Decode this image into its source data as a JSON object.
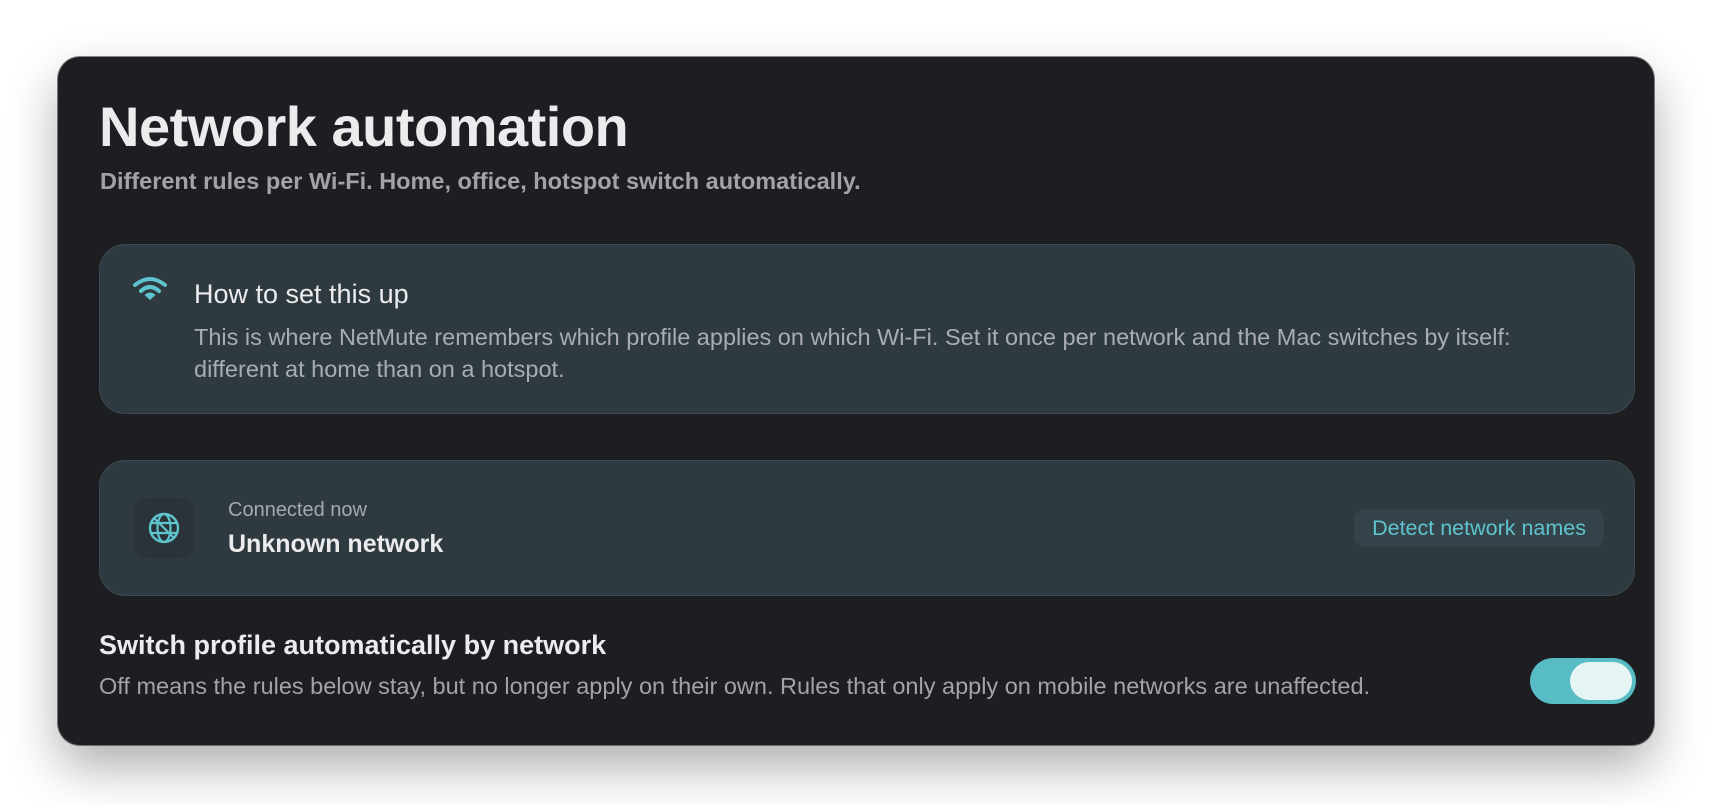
{
  "header": {
    "title": "Network automation",
    "subtitle": "Different rules per Wi-Fi. Home, office, hotspot switch automatically."
  },
  "info_card": {
    "icon": "wifi-icon",
    "title": "How to set this up",
    "body": "This is where NetMute remembers which profile applies on which Wi-Fi. Set it once per network and the Mac switches by itself: different at home than on a hotspot."
  },
  "network_card": {
    "icon": "globe-icon",
    "label": "Connected now",
    "network_name": "Unknown network",
    "detect_button_label": "Detect network names"
  },
  "auto_switch": {
    "title": "Switch profile automatically by network",
    "description": "Off means the rules below stay, but no longer apply on their own. Rules that only apply on mobile networks are unaffected.",
    "enabled": true
  },
  "colors": {
    "window_background": "#1d1e21",
    "card_background": "#2f3940",
    "accent": "#5ec5cf",
    "toggle_on": "#57bcc3"
  }
}
